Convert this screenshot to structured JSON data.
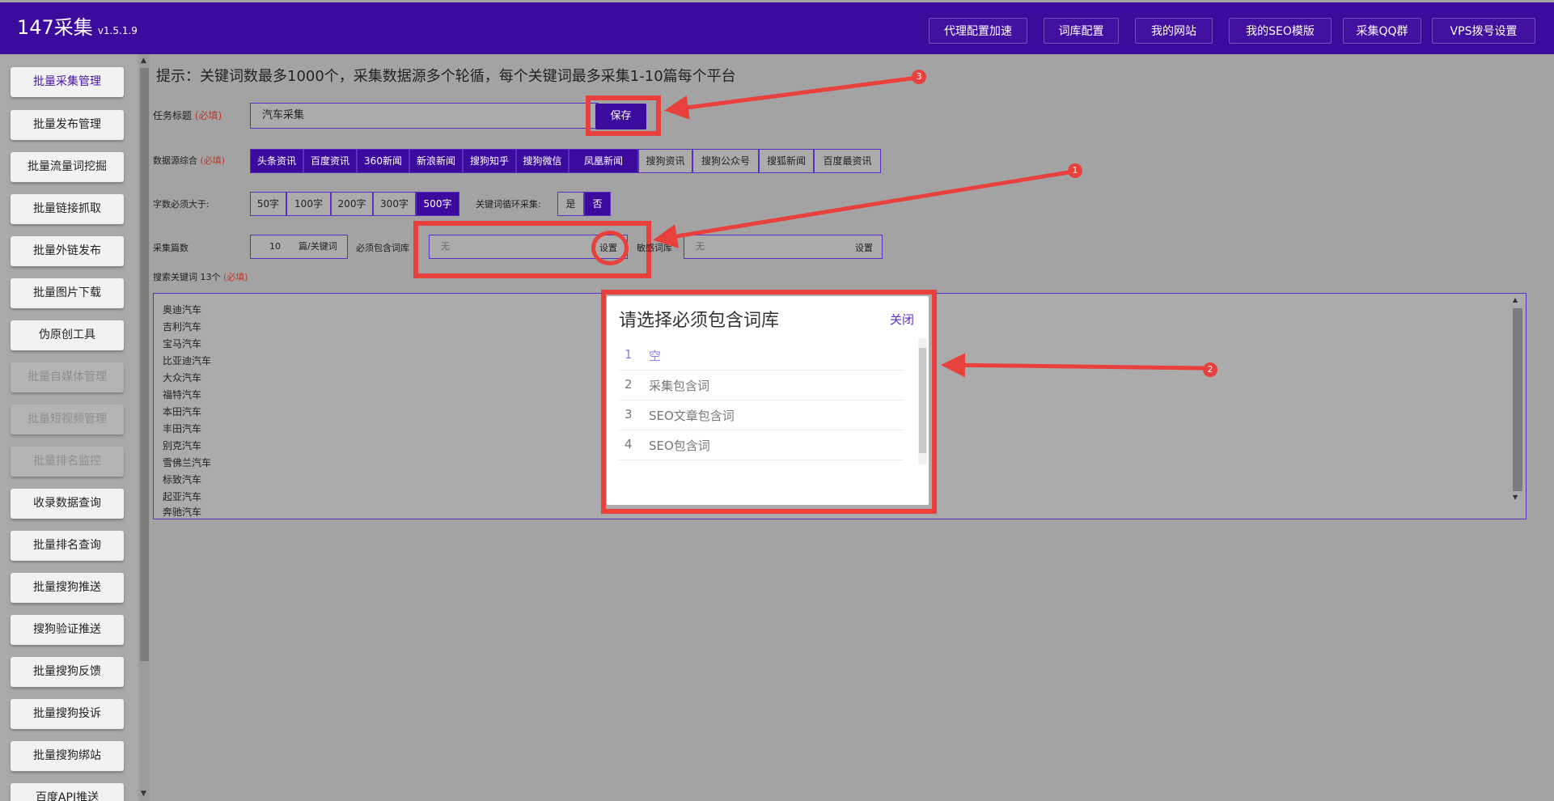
{
  "app": {
    "name": "147采集",
    "version": "v1.5.1.9"
  },
  "top_nav": [
    "代理配置加速",
    "词库配置",
    "我的网站",
    "我的SEO模版",
    "采集QQ群",
    "VPS拨号设置"
  ],
  "sidebar": [
    "批量采集管理",
    "批量发布管理",
    "批量流量词挖掘",
    "批量链接抓取",
    "批量外链发布",
    "批量图片下载",
    "伪原创工具",
    "批量自媒体管理",
    "批量短视频管理",
    "批量排名监控",
    "收录数据查询",
    "批量排名查询",
    "批量搜狗推送",
    "搜狗验证推送",
    "批量搜狗反馈",
    "批量搜狗投诉",
    "批量搜狗绑站",
    "百度API推送"
  ],
  "sidebar_active": "批量采集管理",
  "sidebar_disabled": [
    "批量自媒体管理",
    "批量短视频管理",
    "批量排名监控"
  ],
  "tip": "提示：关键词数最多1000个，采集数据源多个轮循，每个关键词最多采集1-10篇每个平台",
  "form": {
    "required_mark": "(必填)",
    "task_title_label": "任务标题",
    "task_title_value": "汽车采集",
    "save_label": "保存",
    "sources_label": "数据源综合",
    "sources": [
      {
        "label": "头条资讯",
        "on": true
      },
      {
        "label": "百度资讯",
        "on": true
      },
      {
        "label": "360新闻",
        "on": true
      },
      {
        "label": "新浪新闻",
        "on": true
      },
      {
        "label": "搜狗知乎",
        "on": true
      },
      {
        "label": "搜狗微信",
        "on": true
      },
      {
        "label": "凤凰新闻",
        "on": true
      },
      {
        "label": "搜狗资讯",
        "on": false
      },
      {
        "label": "搜狗公众号",
        "on": false
      },
      {
        "label": "搜狐新闻",
        "on": false
      },
      {
        "label": "百度最资讯",
        "on": false
      }
    ],
    "min_words_label": "字数必须大于:",
    "min_words": [
      "50字",
      "100字",
      "200字",
      "300字",
      "500字"
    ],
    "min_words_selected": "500字",
    "loop_label": "关键词循环采集:",
    "loop_options": [
      "是",
      "否"
    ],
    "loop_selected": "否",
    "count_label": "采集篇数",
    "count_value": "10",
    "count_unit": "篇/关键词",
    "must_include_label": "必须包含词库",
    "must_include_value": "无",
    "set_label": "设置",
    "exclude_label": "敏感词库",
    "exclude_value": "无",
    "keywords_label": "搜索关键词",
    "keywords_count": "13个",
    "keywords": [
      "奥迪汽车",
      "吉利汽车",
      "宝马汽车",
      "比亚迪汽车",
      "大众汽车",
      "福特汽车",
      "本田汽车",
      "丰田汽车",
      "别克汽车",
      "雪佛兰汽车",
      "标致汽车",
      "起亚汽车",
      "奔驰汽车"
    ]
  },
  "modal": {
    "title": "请选择必须包含词库",
    "close_label": "关闭",
    "items": [
      {
        "n": "1",
        "label": "空",
        "selected": true
      },
      {
        "n": "2",
        "label": "采集包含词",
        "selected": false
      },
      {
        "n": "3",
        "label": "SEO文章包含词",
        "selected": false
      },
      {
        "n": "4",
        "label": "SEO包含词",
        "selected": false
      }
    ]
  },
  "annotations": [
    "1",
    "2",
    "3"
  ],
  "colors": {
    "brand": "#3d0a9e",
    "annotation": "#e8403d",
    "overlay": "#a3a3a3"
  }
}
